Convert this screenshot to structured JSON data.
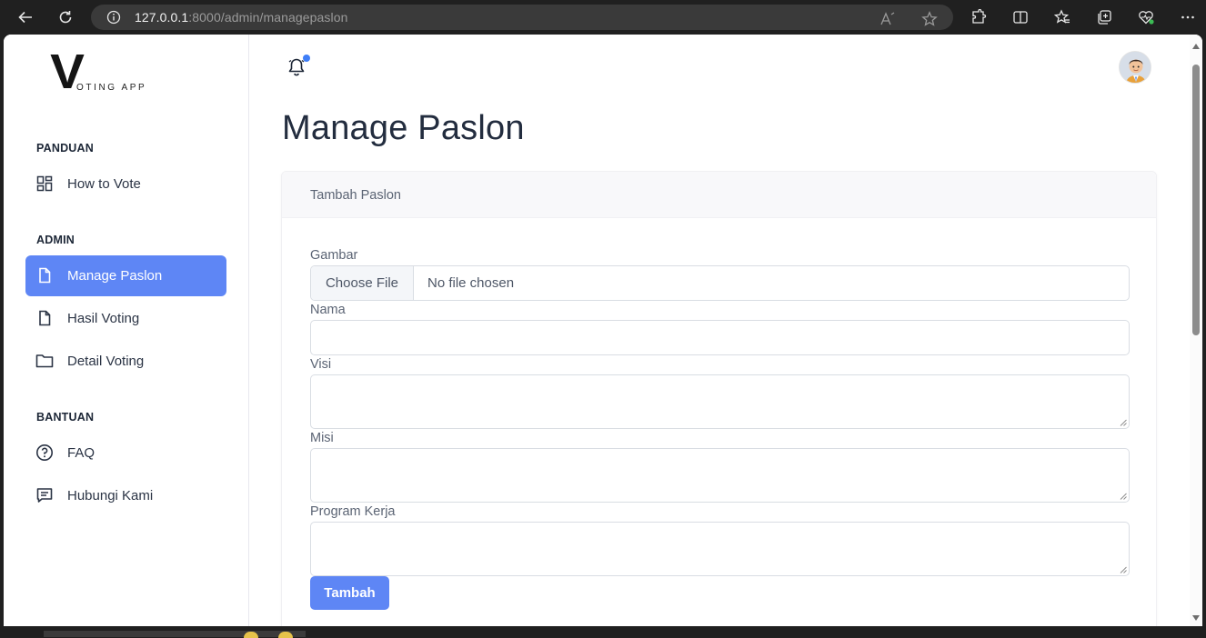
{
  "browser": {
    "url_host": "127.0.0.1",
    "url_rest": ":8000/admin/managepaslon",
    "icons": [
      "back-icon",
      "refresh-icon",
      "info-icon",
      "read-aloud-icon",
      "favorite-star-icon",
      "extensions-icon",
      "split-screen-icon",
      "favorites-icon",
      "collections-icon",
      "browser-health-icon",
      "more-icon"
    ]
  },
  "sidebar": {
    "logo_letter": "V",
    "logo_text": "OTING APP",
    "sections": [
      {
        "title": "PANDUAN",
        "items": [
          {
            "label": "How to Vote",
            "icon": "grid-icon",
            "active": false
          }
        ]
      },
      {
        "title": "ADMIN",
        "items": [
          {
            "label": "Manage Paslon",
            "icon": "document-icon",
            "active": true
          },
          {
            "label": "Hasil Voting",
            "icon": "document-icon",
            "active": false
          },
          {
            "label": "Detail Voting",
            "icon": "folder-icon",
            "active": false
          }
        ]
      },
      {
        "title": "BANTUAN",
        "items": [
          {
            "label": "FAQ",
            "icon": "question-icon",
            "active": false
          },
          {
            "label": "Hubungi Kami",
            "icon": "chat-icon",
            "active": false
          }
        ]
      }
    ]
  },
  "header": {
    "has_notification": true
  },
  "main": {
    "title": "Manage Paslon",
    "card_title": "Tambah Paslon",
    "form": {
      "gambar_label": "Gambar",
      "file_button": "Choose File",
      "file_status": "No file chosen",
      "nama_label": "Nama",
      "nama_value": "",
      "visi_label": "Visi",
      "visi_value": "",
      "misi_label": "Misi",
      "misi_value": "",
      "program_label": "Program Kerja",
      "program_value": "",
      "submit_label": "Tambah"
    }
  },
  "colors": {
    "accent": "#5e86f5",
    "notification": "#3f7ef7",
    "text_dark": "#232d3f"
  }
}
